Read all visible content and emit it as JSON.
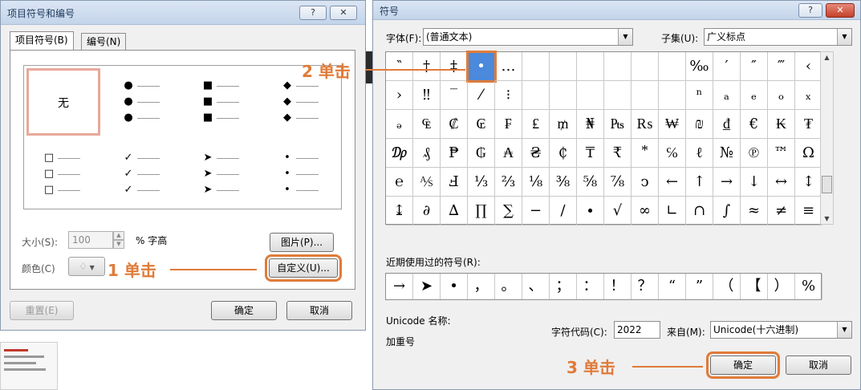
{
  "left_dialog": {
    "title": "项目符号和编号",
    "help_btn": "?",
    "close_btn": "✕",
    "tabs": [
      "项目符号(B)",
      "编号(N)"
    ],
    "none_label": "无",
    "size_label": "大小(S):",
    "size_value": "100",
    "size_unit": "% 字高",
    "color_label": "颜色(C)",
    "picture_button": "图片(P)...",
    "customize_button": "自定义(U)...",
    "reset_button": "重置(E)",
    "ok_button": "确定",
    "cancel_button": "取消",
    "bullet_sets": [
      {
        "glyph": "●"
      },
      {
        "glyph": "■"
      },
      {
        "glyph": "◆"
      },
      {
        "glyph": "□"
      },
      {
        "glyph": "✓"
      },
      {
        "glyph": "➤"
      },
      {
        "glyph": "•"
      }
    ]
  },
  "symbol_dialog": {
    "title": "符号",
    "help_btn": "?",
    "close_btn": "✕",
    "font_label": "字体(F):",
    "font_value": "(普通文本)",
    "subset_label": "子集(U):",
    "subset_value": "广义标点",
    "grid_rows": [
      [
        "‶",
        "†",
        "‡",
        "•",
        "…",
        "",
        "",
        "",
        "",
        "",
        "",
        "‰",
        "′",
        "″",
        "‴",
        "‹"
      ],
      [
        "›",
        "‼",
        "‾",
        "⁄",
        "⁝",
        "",
        "",
        "",
        "",
        "",
        "",
        "ⁿ",
        "ₐ",
        "ₑ",
        "ₒ",
        "ₓ"
      ],
      [
        "ₔ",
        "₠",
        "₡",
        "₢",
        "₣",
        "₤",
        "₥",
        "₦",
        "₧",
        "₨",
        "₩",
        "₪",
        "₫",
        "€",
        "₭",
        "₮"
      ],
      [
        "₯",
        "₰",
        "₱",
        "₲",
        "₳",
        "₴",
        "₵",
        "₸",
        "₹",
        "⃰",
        "℅",
        "ℓ",
        "№",
        "℗",
        "™",
        "Ω"
      ],
      [
        "℮",
        "⅍",
        "Ⅎ",
        "⅓",
        "⅔",
        "⅛",
        "⅜",
        "⅝",
        "⅞",
        "ↄ",
        "←",
        "↑",
        "→",
        "↓",
        "↔",
        "↕"
      ],
      [
        "↨",
        "∂",
        "∆",
        "∏",
        "∑",
        "−",
        "∕",
        "∙",
        "√",
        "∞",
        "∟",
        "∩",
        "∫",
        "≈",
        "≠",
        "≡"
      ]
    ],
    "recent_label": "近期使用过的符号(R):",
    "recent_symbols": [
      "→",
      "➤",
      "•",
      "，",
      "。",
      "、",
      "；",
      "：",
      "！",
      "？",
      "“",
      "”",
      "（",
      "【",
      "）",
      "%"
    ],
    "unicode_name_label": "Unicode 名称:",
    "unicode_name_value": "加重号",
    "char_code_label": "字符代码(C):",
    "char_code_value": "2022",
    "from_label": "来自(M):",
    "from_value": "Unicode(十六进制)",
    "ok_button": "确定",
    "cancel_button": "取消"
  },
  "annotations": {
    "step1": "1 单击",
    "step2": "2 单击",
    "step3": "3 单击"
  },
  "colors": {
    "annotation": "#e07b39",
    "selected_cell": "#4a89dc"
  }
}
